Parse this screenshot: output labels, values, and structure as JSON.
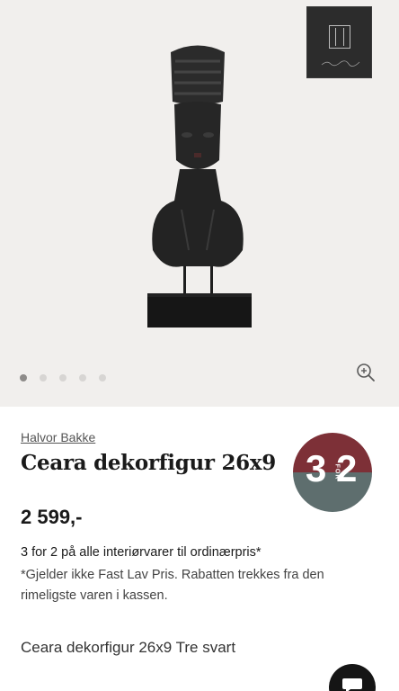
{
  "gallery": {
    "image_alt_icon": "sculpture-image",
    "logo_icon": "halvor-bakke-logo",
    "slide_count": 5,
    "active_slide": 1,
    "zoom_icon": "zoom-in-icon"
  },
  "product": {
    "brand": "Halvor Bakke",
    "title": "Ceara dekorfigur 26x9",
    "price": "2 599,-",
    "variant": "Ceara dekorfigur 26x9 Tre svart"
  },
  "badge": {
    "num_left": "3",
    "for_text": "FOR",
    "num_right": "2",
    "color_top": "#7d3037",
    "color_bottom": "#5e6e6e"
  },
  "promo": {
    "headline": "3 for 2 på alle interiørvarer til ordinærpris*",
    "note": "*Gjelder ikke Fast Lav Pris. Rabatten trekkes fra den rimeligste varen i kassen."
  },
  "chat": {
    "icon": "chat-icon"
  }
}
